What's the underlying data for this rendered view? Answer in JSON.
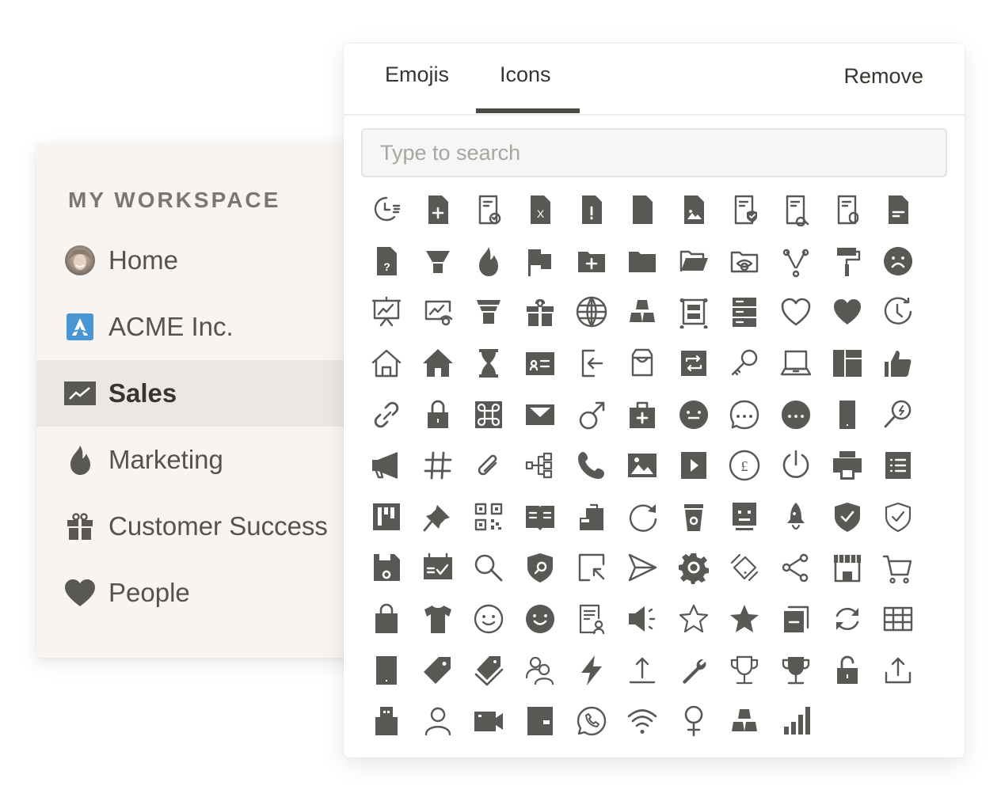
{
  "sidebar": {
    "section_label": "MY WORKSPACE",
    "items": [
      {
        "label": "Home",
        "icon": "avatar-photo",
        "active": false
      },
      {
        "label": "ACME Inc.",
        "icon": "acme-logo-icon",
        "active": false
      },
      {
        "label": "Sales",
        "icon": "chart-line-icon",
        "active": true
      },
      {
        "label": "Marketing",
        "icon": "flame-icon",
        "active": false
      },
      {
        "label": "Customer Success",
        "icon": "gift-icon",
        "active": false
      },
      {
        "label": "People",
        "icon": "heart-icon",
        "active": false
      }
    ]
  },
  "picker": {
    "tabs": [
      {
        "label": "Emojis",
        "active": false
      },
      {
        "label": "Icons",
        "active": true
      }
    ],
    "remove_label": "Remove",
    "search": {
      "placeholder": "Type to search",
      "value": ""
    },
    "icon_color": "#5a5855",
    "icons": [
      "clock-list",
      "file-add",
      "file-check",
      "file-x",
      "file-alert",
      "file",
      "file-image",
      "file-shield",
      "file-search",
      "file-refresh",
      "file-text",
      "file-question",
      "funnel",
      "flame",
      "flag",
      "folder-add",
      "folder",
      "folder-open",
      "folder-eye",
      "fork",
      "paint-roller",
      "face-sad",
      "presentation-chart",
      "chart-eye",
      "funnel-steps",
      "gift",
      "globe",
      "gold-bars",
      "frame",
      "server",
      "heart-outline",
      "heart",
      "clock-refresh",
      "home-outline",
      "home",
      "hourglass",
      "id-card",
      "sign-in",
      "inbox",
      "repeat-box",
      "key",
      "laptop",
      "layout",
      "thumbs-up",
      "link",
      "lock",
      "command",
      "mail",
      "male",
      "medkit",
      "face-neutral",
      "chat-outline",
      "chat-dots",
      "mobile",
      "zoom-bolt",
      "megaphone",
      "hashtag",
      "paperclip",
      "hierarchy",
      "phone",
      "image",
      "play",
      "pound",
      "power",
      "printer",
      "list",
      "kanban",
      "pin",
      "qr-code",
      "book-open",
      "clipboard",
      "redo",
      "coffee-cup",
      "robot",
      "rocket",
      "shield-check",
      "shield-check-outline",
      "floppy",
      "calendar-check",
      "search",
      "shield-search",
      "cursor-box",
      "send",
      "gear",
      "device-rotate",
      "share",
      "store",
      "cart",
      "shopping-bag",
      "tshirt",
      "smile-outline",
      "smile",
      "certificate",
      "volume",
      "star-outline",
      "star",
      "copy-minus",
      "sync",
      "table",
      "tablet",
      "tag",
      "tags",
      "users",
      "bolt",
      "upload-line",
      "wrench",
      "trophy-outline",
      "trophy",
      "unlock",
      "upload",
      "usb",
      "user",
      "video",
      "wallet",
      "whatsapp",
      "wifi",
      "female",
      "gold-bars",
      "bar-chart"
    ]
  }
}
